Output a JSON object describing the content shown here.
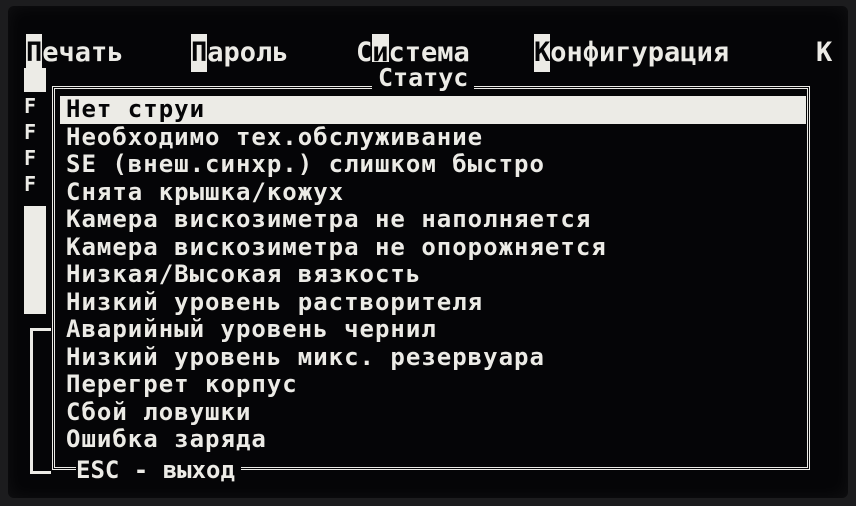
{
  "menu": {
    "items": [
      {
        "hot": "П",
        "rest": "ечать"
      },
      {
        "hot": "П",
        "rest": "ароль"
      },
      {
        "pre": "С",
        "hot": "и",
        "rest": "стема"
      },
      {
        "hot": "К",
        "rest": "онфигурация"
      }
    ],
    "overflow": "К"
  },
  "sidebar": {
    "flags": [
      "F",
      "F",
      "F",
      "F"
    ]
  },
  "status_panel": {
    "title": "Статус",
    "items": [
      "Нет струи",
      "Необходимо тех.обслуживание",
      "SE (внеш.синхр.) слишком быстро",
      "Снята крышка/кожух",
      "Камера вискозиметра не наполняется",
      "Камера вискозиметра не опорожняется",
      "Низкая/Высокая вязкость",
      "Низкий уровень растворителя",
      "Аварийный уровень чернил",
      "Низкий уровень микс. резервуара",
      "Перегрет корпус",
      "Сбой ловушки",
      "Ошибка заряда"
    ],
    "selected_index": 0,
    "footer": "ESC - выход"
  },
  "colors": {
    "screen_bg": "#050507",
    "text": "#ecebe6"
  }
}
